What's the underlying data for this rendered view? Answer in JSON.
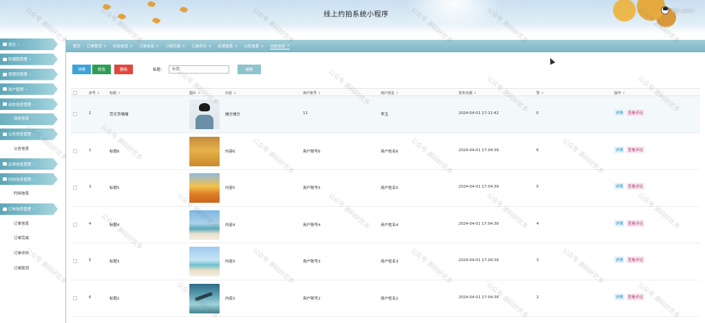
{
  "header": {
    "title": "线上约拍系统小程序",
    "user_label": "欢迎 admin"
  },
  "sidebar": {
    "items": [
      {
        "label": "首页",
        "type": "menu"
      },
      {
        "label": "轮播图管理",
        "type": "menu"
      },
      {
        "label": "管理员管理",
        "type": "menu"
      },
      {
        "label": "用户管理",
        "type": "menu"
      },
      {
        "label": "动态信息管理",
        "type": "menu"
      },
      {
        "label": "动态信息",
        "type": "sub-active"
      },
      {
        "label": "公告信息管理",
        "type": "menu"
      },
      {
        "label": "公告信息",
        "type": "sub"
      },
      {
        "label": "反馈信息管理",
        "type": "menu"
      },
      {
        "label": "约拍信息管理",
        "type": "menu"
      },
      {
        "label": "约拍信息",
        "type": "sub"
      },
      {
        "label": "订单信息管理",
        "type": "menu"
      },
      {
        "label": "订单信息",
        "type": "sub"
      },
      {
        "label": "订单完成",
        "type": "sub"
      },
      {
        "label": "订单评价",
        "type": "sub"
      },
      {
        "label": "订单取消",
        "type": "sub"
      }
    ]
  },
  "tabs": [
    {
      "label": "首页",
      "closable": false
    },
    {
      "label": "订单取消",
      "closable": true
    },
    {
      "label": "约拍信息",
      "closable": true
    },
    {
      "label": "订单信息",
      "closable": true
    },
    {
      "label": "订单完成",
      "closable": true
    },
    {
      "label": "订单评价",
      "closable": true
    },
    {
      "label": "反馈信息",
      "closable": true
    },
    {
      "label": "公告信息",
      "closable": true
    },
    {
      "label": "动态信息",
      "closable": true,
      "active": true
    }
  ],
  "toolbar": {
    "detail_label": "详情",
    "edit_label": "修改",
    "delete_label": "删除",
    "search_label": "标题：",
    "search_placeholder": "标题",
    "search_button": "搜索"
  },
  "table": {
    "columns": [
      "序号",
      "标题",
      "图片",
      "内容",
      "用户账号",
      "用户姓名",
      "发布日期",
      "赞",
      "操作"
    ],
    "rows": [
      {
        "index": "1",
        "title": "范文芳喵喵",
        "content": "摊方摊方",
        "account": "11",
        "name": "李玉",
        "date": "2024-04-01 17:11:42",
        "likes": "0"
      },
      {
        "index": "2",
        "title": "标题6",
        "content": "内容6",
        "account": "用户账号6",
        "name": "用户姓名6",
        "date": "2024-04-01 17:04:39",
        "likes": "6"
      },
      {
        "index": "3",
        "title": "标题5",
        "content": "内容5",
        "account": "用户账号5",
        "name": "用户姓名5",
        "date": "2024-04-01 17:04:39",
        "likes": "5"
      },
      {
        "index": "4",
        "title": "标题4",
        "content": "内容4",
        "account": "用户账号4",
        "name": "用户姓名4",
        "date": "2024-04-01 17:04:39",
        "likes": "4"
      },
      {
        "index": "5",
        "title": "标题3",
        "content": "内容3",
        "account": "用户账号3",
        "name": "用户姓名3",
        "date": "2024-04-01 17:04:39",
        "likes": "3"
      },
      {
        "index": "6",
        "title": "标题2",
        "content": "内容2",
        "account": "用户账号2",
        "name": "用户姓名2",
        "date": "2024-04-01 17:04:39",
        "likes": "2"
      }
    ],
    "row_actions": {
      "detail": "详情",
      "comments": "查看评论"
    }
  },
  "watermark": "公众号 源码好优多"
}
